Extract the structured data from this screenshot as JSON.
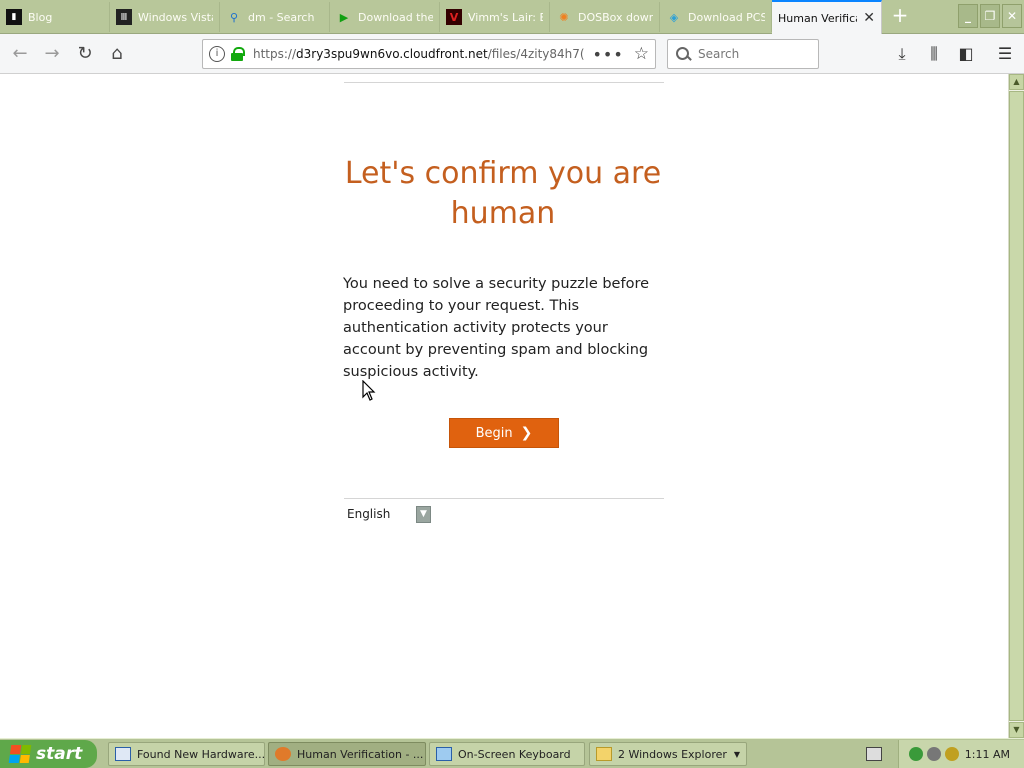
{
  "tabs": [
    {
      "title": "Blog",
      "icon": "terminal-icon"
    },
    {
      "title": "Windows Vista",
      "icon": "museum-icon"
    },
    {
      "title": "dm - Search",
      "icon": "search-icon"
    },
    {
      "title": "Download the",
      "icon": "play-icon"
    },
    {
      "title": "Vimm's Lair: Er",
      "icon": "vimm-icon"
    },
    {
      "title": "DOSBox down",
      "icon": "dosbox-icon"
    },
    {
      "title": "Download PCS",
      "icon": "box-icon"
    },
    {
      "title": "Human Verification",
      "icon": "none",
      "active": true
    }
  ],
  "toolbar": {
    "url_scheme": "https://",
    "url_host": "d3ry3spu9wn6vo.cloudfront.net",
    "url_path": "/files/4zity84h7(",
    "search_placeholder": "Search"
  },
  "page": {
    "heading": "Let's confirm you are human",
    "description": "You need to solve a security puzzle before proceeding to your request. This authentication activity protects your account by preventing spam and blocking suspicious activity.",
    "begin_label": "Begin",
    "language": "English"
  },
  "taskbar": {
    "start_label": "start",
    "tasks": [
      {
        "label": "Found New Hardware..."
      },
      {
        "label": "Human Verification - ..."
      },
      {
        "label": "On-Screen Keyboard"
      },
      {
        "label": "2 Windows Explorer"
      }
    ],
    "clock": "1:11 AM"
  },
  "colors": {
    "accent": "#e0620f",
    "heading": "#c45f1f",
    "chrome": "#b8c79a"
  }
}
